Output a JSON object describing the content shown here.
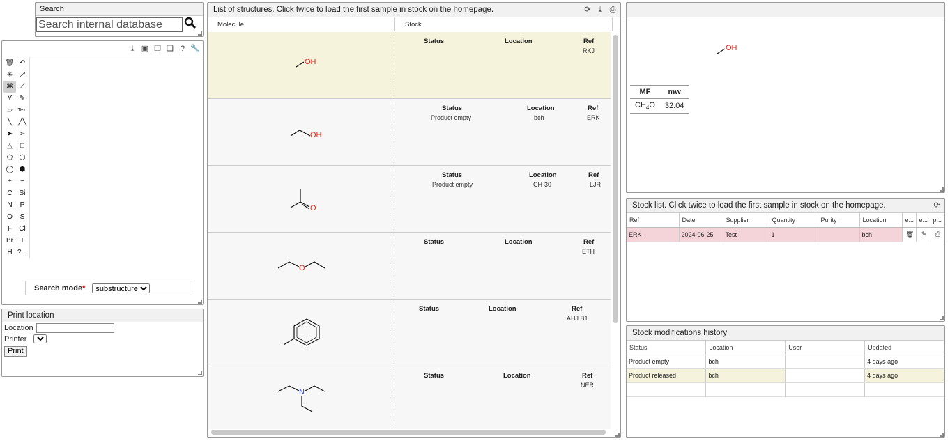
{
  "search": {
    "title": "Search",
    "placeholder": "Search internal database",
    "search_icon": "magnifier-icon"
  },
  "editor": {
    "toolbar_icons": [
      "download-icon",
      "image-icon",
      "copy-icon",
      "paste-icon",
      "help-icon",
      "wrench-icon"
    ],
    "tools": [
      "🗑",
      "↶",
      "✳",
      "⤢",
      "⌘",
      "⟋",
      "Y",
      "✎",
      "▱",
      "Text",
      "╲",
      "╱╲",
      "➤",
      "➢",
      "△",
      "□",
      "⬠",
      "⬡",
      "◯",
      "⬢",
      "+",
      "−",
      "C",
      "Si",
      "N",
      "P",
      "O",
      "S",
      "F",
      "Cl",
      "Br",
      "I",
      "H",
      "?..."
    ],
    "search_mode_label": "Search mode",
    "search_mode_required": "*",
    "search_mode_value": "substructure"
  },
  "print": {
    "title": "Print location",
    "location_label": "Location",
    "printer_label": "Printer",
    "button": "Print"
  },
  "structures": {
    "title": "List of structures. Click twice to load the first sample in stock on the homepage.",
    "col_molecule": "Molecule",
    "col_stock": "Stock",
    "stock_headers": {
      "status": "Status",
      "location": "Location",
      "ref": "Ref"
    },
    "rows": [
      {
        "status": "",
        "location": "",
        "ref": "RKJ"
      },
      {
        "status": "Product empty",
        "location": "bch",
        "ref": "ERK"
      },
      {
        "status": "Product empty",
        "location": "CH-30",
        "ref": "LJR"
      },
      {
        "status": "",
        "location": "",
        "ref": "ETH"
      },
      {
        "status": "",
        "location": "",
        "ref": "AHJ B1"
      },
      {
        "status": "",
        "location": "",
        "ref": "NER"
      }
    ]
  },
  "viewer": {
    "mf_header": "MF",
    "mw_header": "mw",
    "mf_c": "CH",
    "mf_sub": "4",
    "mf_o": "O",
    "mw_value": "32.04"
  },
  "stock_list": {
    "title": "Stock list. Click twice to load the first sample in stock on the homepage.",
    "headers": [
      "Ref",
      "Date",
      "Supplier",
      "Quantity",
      "Purity",
      "Location",
      "e...",
      "e...",
      "p..."
    ],
    "row": {
      "ref": "ERK-",
      "date": "2024-06-25",
      "supplier": "Test",
      "quantity": "1",
      "purity": "",
      "location": "bch"
    }
  },
  "history": {
    "title": "Stock modifications history",
    "headers": [
      "Status",
      "Location",
      "User",
      "Updated"
    ],
    "rows": [
      {
        "status": "Product empty",
        "location": "bch",
        "user": "",
        "updated": "4 days ago"
      },
      {
        "status": "Product released",
        "location": "bch",
        "user": "",
        "updated": "4 days ago"
      }
    ]
  },
  "colors": {
    "highlight": "#f5f3dc",
    "pink_row": "#f5d4d9",
    "oxygen": "#e0261b",
    "nitrogen": "#2a3fd6"
  }
}
